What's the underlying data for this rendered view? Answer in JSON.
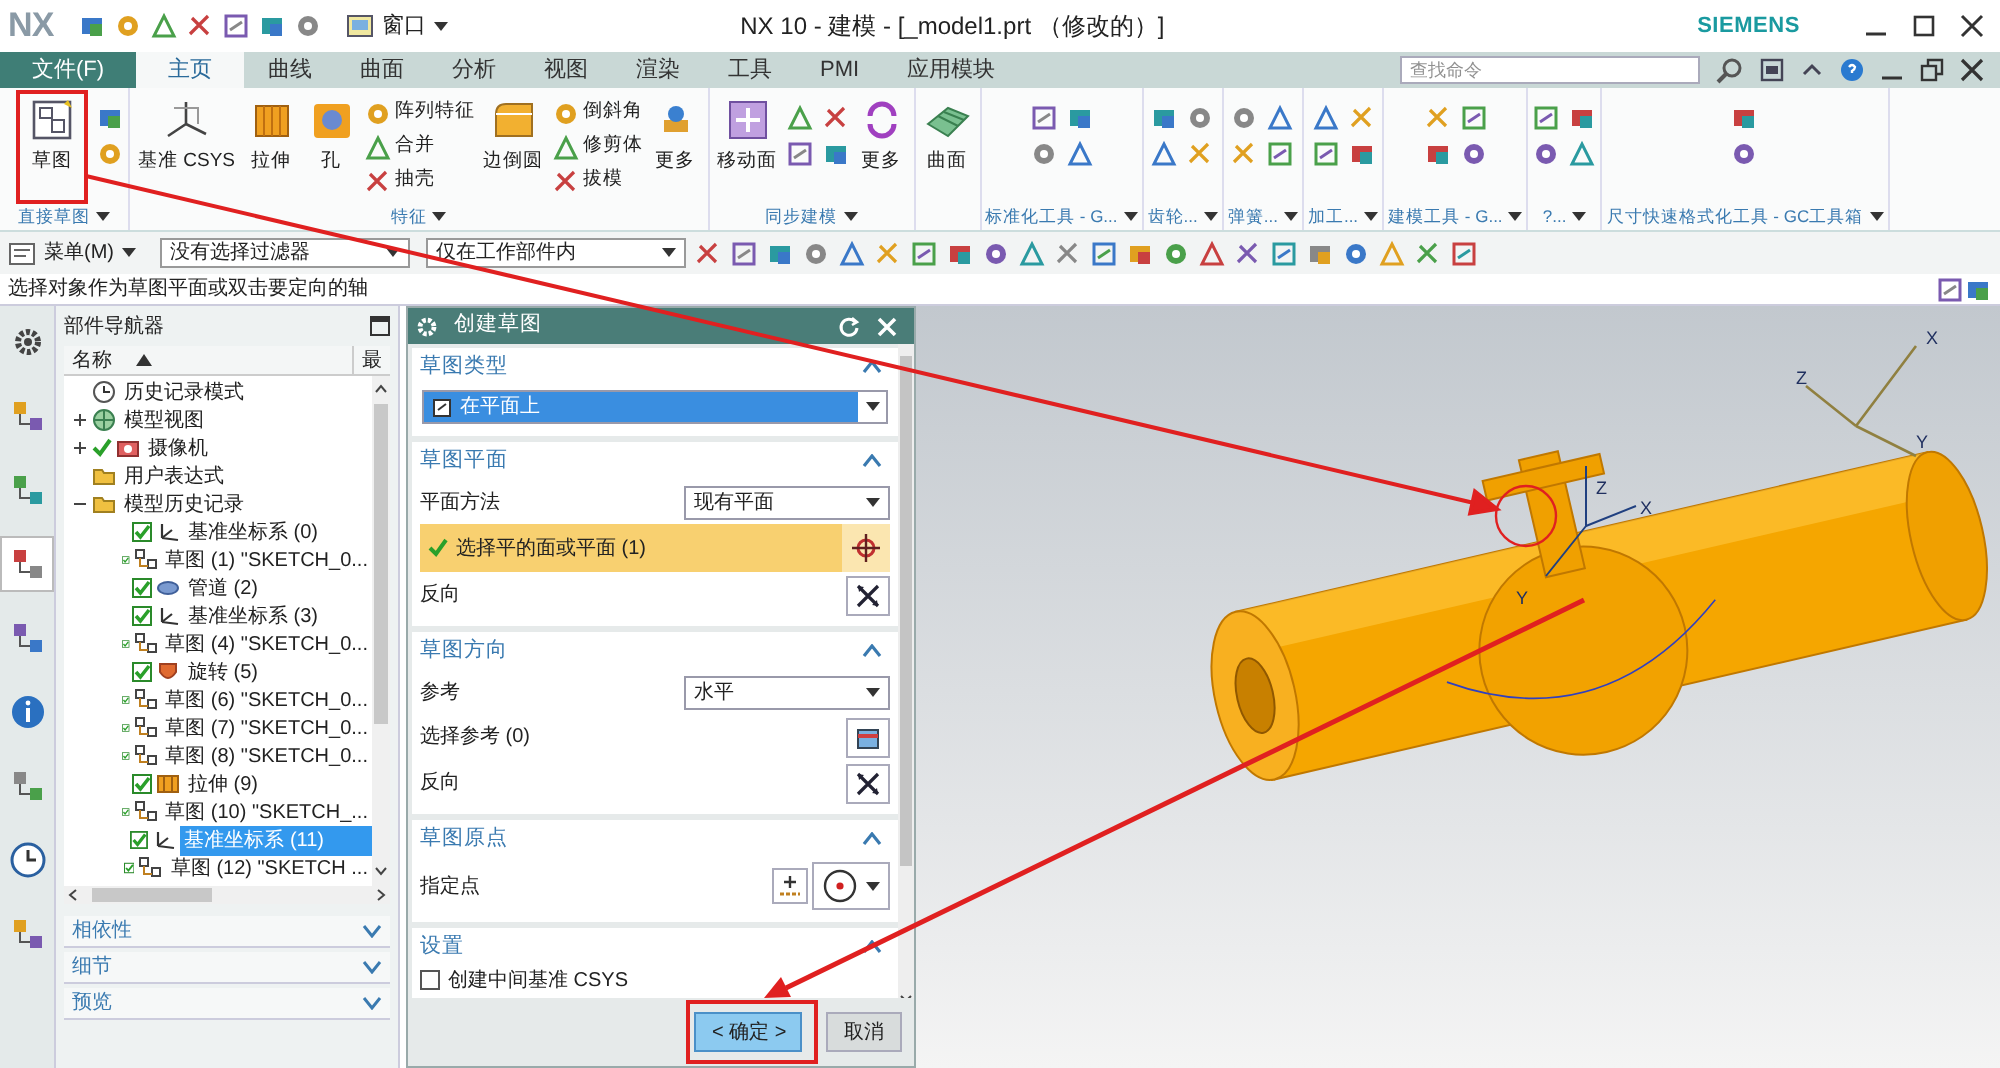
{
  "title_bar": {
    "logo": "NX",
    "window_menu": "窗口",
    "title": "NX 10 - 建模 - [_model1.prt （修改的）]",
    "brand": "SIEMENS"
  },
  "tabs": [
    {
      "label": "文件(F)",
      "kind": "file",
      "selected": false
    },
    {
      "label": "主页",
      "kind": "tab",
      "selected": true
    },
    {
      "label": "曲线",
      "kind": "tab",
      "selected": false
    },
    {
      "label": "曲面",
      "kind": "tab",
      "selected": false
    },
    {
      "label": "分析",
      "kind": "tab",
      "selected": false
    },
    {
      "label": "视图",
      "kind": "tab",
      "selected": false
    },
    {
      "label": "渲染",
      "kind": "tab",
      "selected": false
    },
    {
      "label": "工具",
      "kind": "tab",
      "selected": false
    },
    {
      "label": "PMI",
      "kind": "tab",
      "selected": false
    },
    {
      "label": "应用模块",
      "kind": "tab",
      "selected": false
    }
  ],
  "search": {
    "placeholder": "查找命令"
  },
  "ribbon": [
    {
      "label": "直接草图",
      "items": [
        {
          "kind": "large",
          "label": "草图"
        },
        {
          "kind": "icons"
        }
      ]
    },
    {
      "label": "特征",
      "items": [
        {
          "kind": "large",
          "label": "基准 CSYS"
        },
        {
          "kind": "large",
          "label": "拉伸"
        },
        {
          "kind": "large",
          "label": "孔"
        },
        {
          "kind": "stack",
          "labels": [
            "阵列特征",
            "合并",
            "抽壳"
          ]
        },
        {
          "kind": "large",
          "label": "边倒圆"
        },
        {
          "kind": "stack",
          "labels": [
            "倒斜角",
            "修剪体",
            "拔模"
          ]
        },
        {
          "kind": "large",
          "label": "更多"
        }
      ]
    },
    {
      "label": "同步建模",
      "items": [
        {
          "kind": "large",
          "label": "移动面"
        },
        {
          "kind": "icons"
        },
        {
          "kind": "large",
          "label": "更多"
        }
      ]
    },
    {
      "items": [
        {
          "kind": "large",
          "label": "曲面"
        }
      ]
    },
    {
      "label": "标准化工具 - G...",
      "items": [
        {
          "kind": "icons"
        }
      ]
    },
    {
      "label": "齿轮...",
      "items": [
        {
          "kind": "icons"
        }
      ]
    },
    {
      "label": "弹簧...",
      "items": [
        {
          "kind": "icons"
        }
      ]
    },
    {
      "label": "加工...",
      "items": [
        {
          "kind": "icons"
        }
      ]
    },
    {
      "label": "建模工具 - G...",
      "items": [
        {
          "kind": "icons"
        }
      ]
    },
    {
      "label": "?...",
      "items": [
        {
          "kind": "icons"
        }
      ]
    },
    {
      "label": "尺寸快速格式化工具 - GC工具箱",
      "items": [
        {
          "kind": "icons"
        }
      ]
    }
  ],
  "toolbar": {
    "menu": "菜单(M)",
    "filter": "没有选择过滤器",
    "scope": "仅在工作部件内"
  },
  "status_line": "选择对象作为草图平面或双击要定向的轴",
  "resource_bar": [
    {
      "kind": "gear",
      "selected": false
    },
    {
      "kind": "assembly",
      "selected": false
    },
    {
      "kind": "constraint",
      "selected": false
    },
    {
      "kind": "part",
      "selected": true
    },
    {
      "kind": "reuse",
      "selected": false
    },
    {
      "kind": "info",
      "selected": false
    },
    {
      "kind": "web",
      "selected": false
    },
    {
      "kind": "history",
      "selected": false
    },
    {
      "kind": "roles",
      "selected": false
    }
  ],
  "navigator": {
    "title": "部件导航器",
    "columns": [
      "名称",
      "最"
    ],
    "tree": [
      {
        "label": "历史记录模式",
        "kind": "clock",
        "selected": false
      },
      {
        "label": "模型视图",
        "kind": "view",
        "expanded": false,
        "selected": false
      },
      {
        "label": "摄像机",
        "kind": "camera",
        "expanded": false,
        "checked": true,
        "selected": false
      },
      {
        "label": "用户表达式",
        "kind": "folder",
        "selected": false
      },
      {
        "label": "模型历史记录",
        "kind": "folder",
        "expanded": true,
        "selected": false,
        "children": [
          {
            "label": "基准坐标系 (0)",
            "kind": "csys",
            "checked": true,
            "selected": false
          },
          {
            "label": "草图 (1) \"SKETCH_0...",
            "kind": "sketch",
            "checked": true,
            "selected": false
          },
          {
            "label": "管道 (2)",
            "kind": "tube",
            "checked": true,
            "selected": false
          },
          {
            "label": "基准坐标系 (3)",
            "kind": "csys",
            "checked": true,
            "selected": false
          },
          {
            "label": "草图 (4) \"SKETCH_0...",
            "kind": "sketch",
            "checked": true,
            "selected": false
          },
          {
            "label": "旋转 (5)",
            "kind": "revolve",
            "checked": true,
            "selected": false
          },
          {
            "label": "草图 (6) \"SKETCH_0...",
            "kind": "sketch",
            "checked": true,
            "selected": false
          },
          {
            "label": "草图 (7) \"SKETCH_0...",
            "kind": "sketch",
            "checked": true,
            "selected": false
          },
          {
            "label": "草图 (8) \"SKETCH_0...",
            "kind": "sketch",
            "checked": true,
            "selected": false
          },
          {
            "label": "拉伸 (9)",
            "kind": "extrude",
            "checked": true,
            "selected": false
          },
          {
            "label": "草图 (10) \"SKETCH_...",
            "kind": "sketch",
            "checked": true,
            "selected": false
          },
          {
            "label": "基准坐标系 (11)",
            "kind": "csys",
            "checked": true,
            "selected": true
          },
          {
            "label": "草图 (12) \"SKETCH ...",
            "kind": "sketch",
            "checked": true,
            "selected": false
          }
        ]
      }
    ],
    "panels": [
      {
        "label": "相依性",
        "expanded": false
      },
      {
        "label": "细节",
        "expanded": false
      },
      {
        "label": "预览",
        "expanded": false
      }
    ]
  },
  "dialog": {
    "title": "创建草图",
    "sections": [
      {
        "title": "草图类型",
        "expanded": true,
        "rows": [
          {
            "kind": "type",
            "value": "在平面上"
          }
        ]
      },
      {
        "title": "草图平面",
        "expanded": true,
        "rows": [
          {
            "kind": "dropdown",
            "label": "平面方法",
            "value": "现有平面"
          },
          {
            "kind": "selection",
            "label": "选择平的面或平面 (1)",
            "complete": true
          },
          {
            "kind": "flip",
            "label": "反向"
          }
        ]
      },
      {
        "title": "草图方向",
        "expanded": true,
        "rows": [
          {
            "kind": "dropdown",
            "label": "参考",
            "value": "水平"
          },
          {
            "kind": "reference",
            "label": "选择参考 (0)"
          },
          {
            "kind": "flip",
            "label": "反向"
          }
        ]
      },
      {
        "title": "草图原点",
        "expanded": true,
        "rows": [
          {
            "kind": "point",
            "label": "指定点"
          }
        ]
      },
      {
        "title": "设置",
        "expanded": true,
        "rows": [
          {
            "kind": "checkbox",
            "label": "创建中间基准 CSYS",
            "checked": false
          }
        ]
      }
    ],
    "buttons": [
      {
        "label": "< 确定 >",
        "kind": "primary"
      },
      {
        "label": "取消",
        "kind": "secondary"
      }
    ]
  },
  "viewport": {
    "axis_labels": [
      "Z",
      "Y",
      "X",
      "X",
      "Z",
      "Y"
    ]
  }
}
